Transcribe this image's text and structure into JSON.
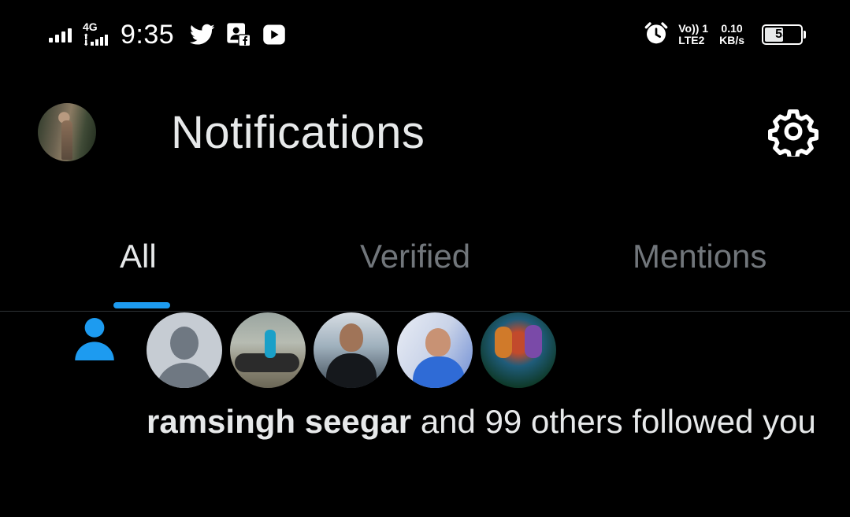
{
  "status_bar": {
    "network": "4G",
    "time": "9:35",
    "apps": [
      "twitter-icon",
      "facebook-pages-icon",
      "youtube-icon"
    ],
    "volte_line1": "Vo)) 1",
    "volte_line2": "LTE2",
    "speed_value": "0.10",
    "speed_unit": "KB/s",
    "battery": "53",
    "battery_level": 0.53
  },
  "header": {
    "title": "Notifications",
    "settings_icon": "gear-icon"
  },
  "tabs": [
    {
      "label": "All",
      "active": true
    },
    {
      "label": "Verified",
      "active": false
    },
    {
      "label": "Mentions",
      "active": false
    }
  ],
  "notification": {
    "type_icon": "person-icon",
    "name": "ramsingh seegar",
    "text": " and 99 others followed you",
    "avatar_count": 5
  },
  "colors": {
    "accent": "#1d9bf0",
    "background": "#000000",
    "text_primary": "#e7e9ea",
    "text_secondary": "#71767b"
  }
}
